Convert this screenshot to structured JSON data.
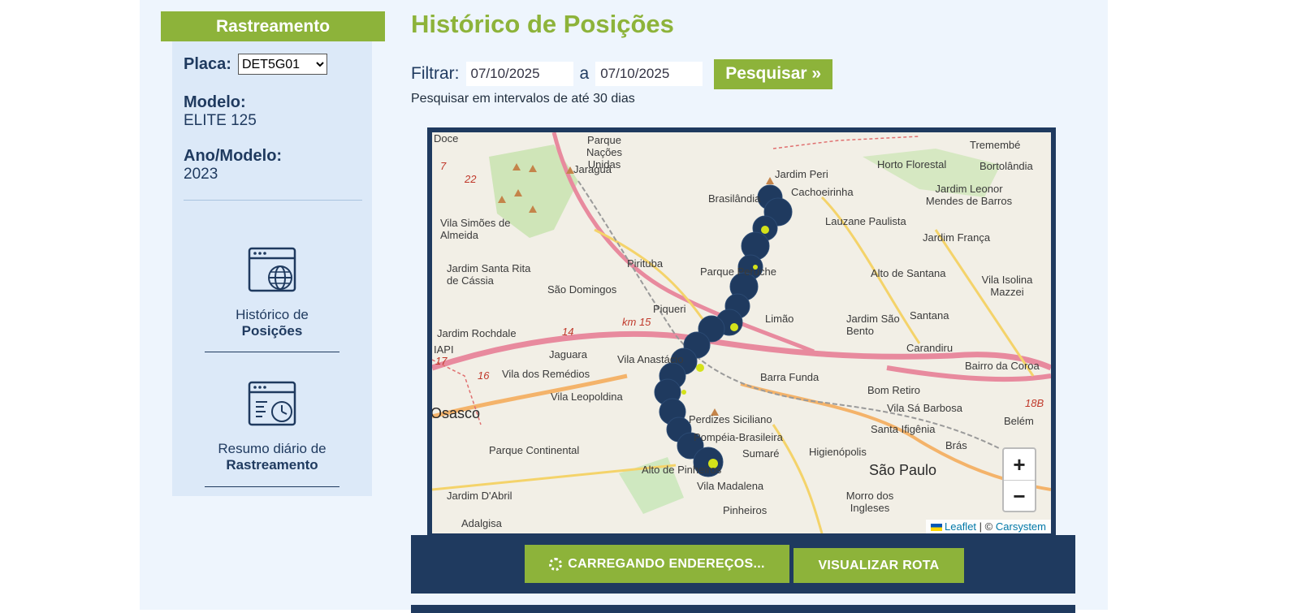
{
  "sidebar": {
    "title": "Rastreamento",
    "placa_label": "Placa:",
    "placa_selected": "DET5G01",
    "modelo_label": "Modelo:",
    "modelo_value": "ELITE 125",
    "ano_label": "Ano/Modelo:",
    "ano_value": "2023",
    "menu": [
      {
        "line1": "Histórico de",
        "line2": "Posições",
        "icon": "browser-globe-icon"
      },
      {
        "line1": "Resumo diário de",
        "line2": "Rastreamento",
        "icon": "browser-clock-icon"
      }
    ]
  },
  "main": {
    "title": "Histórico de Posições",
    "filter_label": "Filtrar:",
    "date_from": "07/10/2025",
    "date_sep": "a",
    "date_to": "07/10/2025",
    "search_label": "Pesquisar »",
    "hint": "Pesquisar em intervalos de até 30 dias"
  },
  "map": {
    "labels": [
      "Doce",
      "Parque Nações Unidas",
      "Jaraguá",
      "Jardim Peri",
      "Cachoeirinha",
      "Horto Florestal",
      "Tremembé",
      "Bortolândia",
      "Brasilândia",
      "Jardim Leonor Mendes de Barros",
      "Lauzane Paulista",
      "Vila Simões de Almeida",
      "Jardim França",
      "Jardim Santa Rita de Cássia",
      "Pirituba",
      "Parque Peruche",
      "Alto de Santana",
      "Vila Isolina Mazzei",
      "São Domingos",
      "Piqueri",
      "Limão",
      "Jardim São Bento",
      "Santana",
      "Jardim Rochdale",
      "IAPI",
      "Jaguara",
      "Vila Anastácio",
      "Carandiru",
      "Bairro da Coroa",
      "Vila dos Remédios",
      "Barra Funda",
      "Bom Retiro",
      "Vila Leopoldina",
      "Vila Sá Barbosa",
      "Belém",
      "Osasco",
      "Perdizes Siciliano",
      "Santa Ifigênia",
      "Parque Continental",
      "Pompéia-Brasileira",
      "Brás",
      "Sumaré",
      "Higienópolis",
      "São Paulo",
      "Alto de Pinheiros",
      "Vila Madalena",
      "Jardim D'Abril",
      "Morro dos Ingleses",
      "Pinheiros",
      "Adalgisa"
    ],
    "zoom_in": "+",
    "zoom_out": "−",
    "attribution_leaflet": "Leaflet",
    "attribution_sep": "| ©",
    "attribution_owner": "Carsystem",
    "road_labels": [
      "22",
      "7",
      "14",
      "16",
      "17",
      "km 15",
      "18B"
    ]
  },
  "actions": {
    "loading_label": "CARREGANDO ENDEREÇOS...",
    "route_label": "VISUALIZAR ROTA"
  },
  "colors": {
    "accent_green": "#8db33a",
    "navy": "#1f3a5f",
    "marker_dot": "#d4e21a"
  }
}
